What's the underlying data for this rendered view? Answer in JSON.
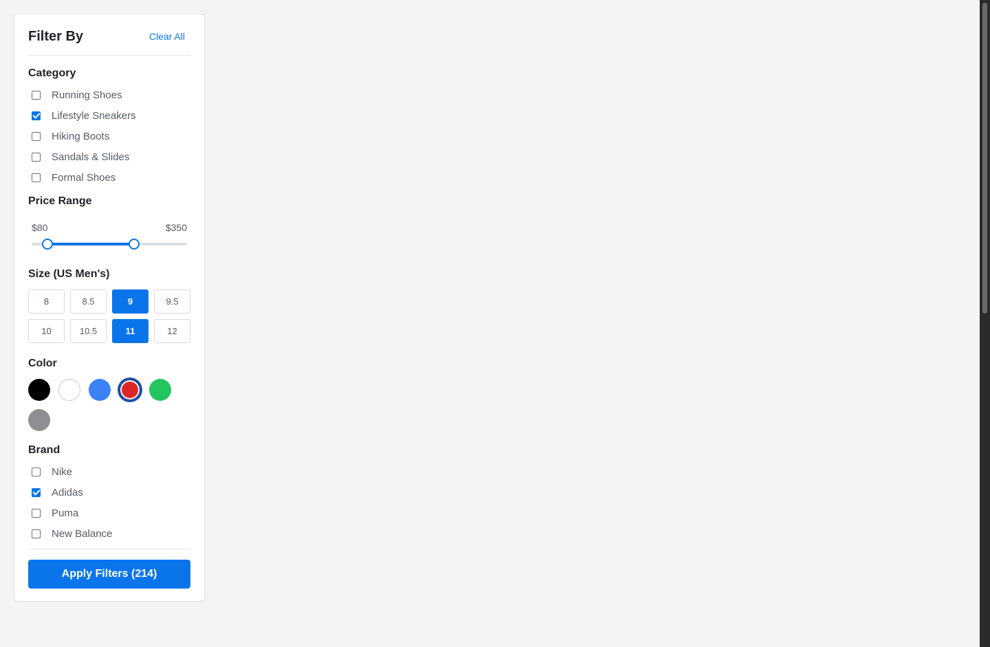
{
  "filter": {
    "title": "Filter By",
    "clear_label": "Clear All",
    "category": {
      "title": "Category",
      "items": [
        {
          "label": "Running Shoes",
          "checked": false
        },
        {
          "label": "Lifestyle Sneakers",
          "checked": true
        },
        {
          "label": "Hiking Boots",
          "checked": false
        },
        {
          "label": "Sandals & Slides",
          "checked": false
        },
        {
          "label": "Formal Shoes",
          "checked": false
        }
      ]
    },
    "price": {
      "title": "Price Range",
      "min_label": "$80",
      "max_label": "$350",
      "low_fraction": 0.1,
      "high_fraction": 0.66
    },
    "size": {
      "title": "Size (US Men's)",
      "options": [
        {
          "label": "8",
          "selected": false
        },
        {
          "label": "8.5",
          "selected": false
        },
        {
          "label": "9",
          "selected": true
        },
        {
          "label": "9.5",
          "selected": false
        },
        {
          "label": "10",
          "selected": false
        },
        {
          "label": "10.5",
          "selected": false
        },
        {
          "label": "11",
          "selected": true
        },
        {
          "label": "12",
          "selected": false
        }
      ]
    },
    "color": {
      "title": "Color",
      "swatches": [
        {
          "name": "black",
          "hex": "#000000",
          "selected": false
        },
        {
          "name": "white",
          "hex": "#ffffff",
          "selected": false
        },
        {
          "name": "blue",
          "hex": "#3b82f6",
          "selected": false
        },
        {
          "name": "red",
          "hex": "#dc2626",
          "selected": true
        },
        {
          "name": "green",
          "hex": "#22c55e",
          "selected": false
        },
        {
          "name": "gray",
          "hex": "#8e8e93",
          "selected": false
        }
      ]
    },
    "brand": {
      "title": "Brand",
      "items": [
        {
          "label": "Nike",
          "checked": false
        },
        {
          "label": "Adidas",
          "checked": true
        },
        {
          "label": "Puma",
          "checked": false
        },
        {
          "label": "New Balance",
          "checked": false
        }
      ]
    },
    "apply_label": "Apply Filters (214)"
  },
  "colors": {
    "accent": "#0a75ea",
    "background": "#f3f4f6"
  }
}
